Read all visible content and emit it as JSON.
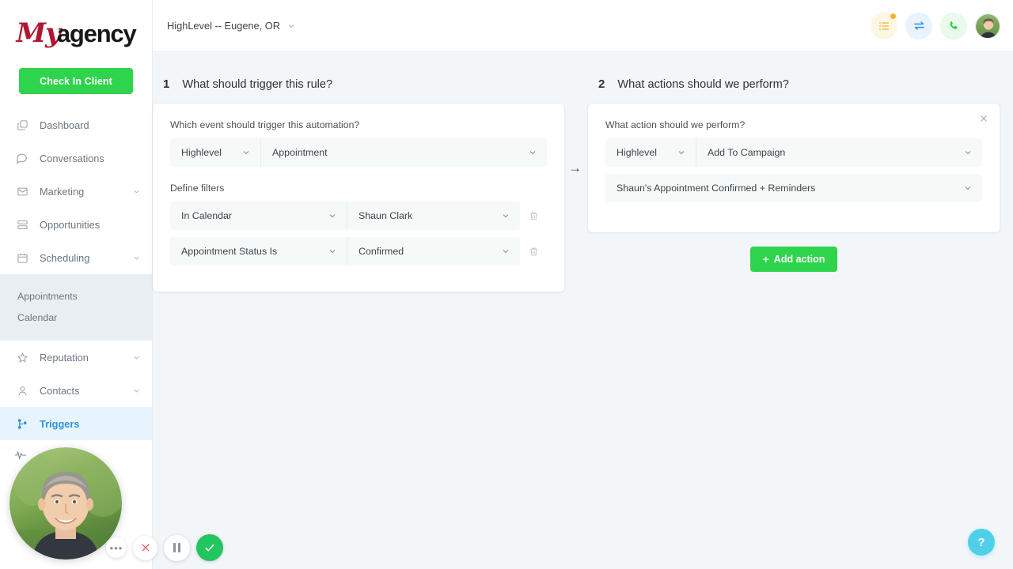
{
  "brand": {
    "logo_part1": "My",
    "logo_part2": "agency",
    "accent_green": "#2ed44c",
    "accent_blue": "#2f93e0",
    "accent_red": "#b01732",
    "help_cyan": "#4fd0e8"
  },
  "sidebar": {
    "check_in_label": "Check In Client",
    "items": [
      {
        "label": "Dashboard",
        "icon": "copy-icon",
        "chevron": false,
        "active": false
      },
      {
        "label": "Conversations",
        "icon": "chat-bubble-icon",
        "chevron": false,
        "active": false
      },
      {
        "label": "Marketing",
        "icon": "mail-icon",
        "chevron": true,
        "active": false
      },
      {
        "label": "Opportunities",
        "icon": "stack-icon",
        "chevron": false,
        "active": false
      },
      {
        "label": "Scheduling",
        "icon": "calendar-icon",
        "chevron": true,
        "active": false
      },
      {
        "label": "Reputation",
        "icon": "star-icon",
        "chevron": true,
        "active": false
      },
      {
        "label": "Contacts",
        "icon": "person-icon",
        "chevron": true,
        "active": false
      },
      {
        "label": "Triggers",
        "icon": "branch-icon",
        "chevron": false,
        "active": true
      }
    ],
    "submenu": [
      {
        "label": "Appointments"
      },
      {
        "label": "Calendar"
      }
    ]
  },
  "topbar": {
    "location": "HighLevel -- Eugene, OR",
    "icons": [
      {
        "name": "tasks-list-icon",
        "badge": true
      },
      {
        "name": "swap-arrows-icon",
        "badge": false
      },
      {
        "name": "phone-icon",
        "badge": false
      }
    ],
    "avatar_name": "avatar"
  },
  "trigger_panel": {
    "number": "1",
    "title": "What should trigger this rule?",
    "event_label": "Which event should trigger this automation?",
    "event_source": "Highlevel",
    "event_type": "Appointment",
    "filters_label": "Define filters",
    "filters": [
      {
        "field": "In Calendar",
        "value": "Shaun Clark"
      },
      {
        "field": "Appointment Status Is",
        "value": "Confirmed"
      }
    ]
  },
  "arrow": "→",
  "action_panel": {
    "number": "2",
    "title": "What actions should we perform?",
    "action_label": "What action should we perform?",
    "action_source": "Highlevel",
    "action_type": "Add To Campaign",
    "campaign": "Shaun's Appointment Confirmed + Reminders",
    "add_action_label": "Add action",
    "add_action_plus": "+"
  },
  "help": {
    "label": "?"
  },
  "video_overlay": {
    "controls": [
      {
        "name": "more-options-button",
        "label": "•••"
      },
      {
        "name": "cancel-recording-button",
        "label": "×"
      },
      {
        "name": "pause-recording-button",
        "label": ""
      },
      {
        "name": "finish-recording-button",
        "label": "✓"
      }
    ]
  }
}
